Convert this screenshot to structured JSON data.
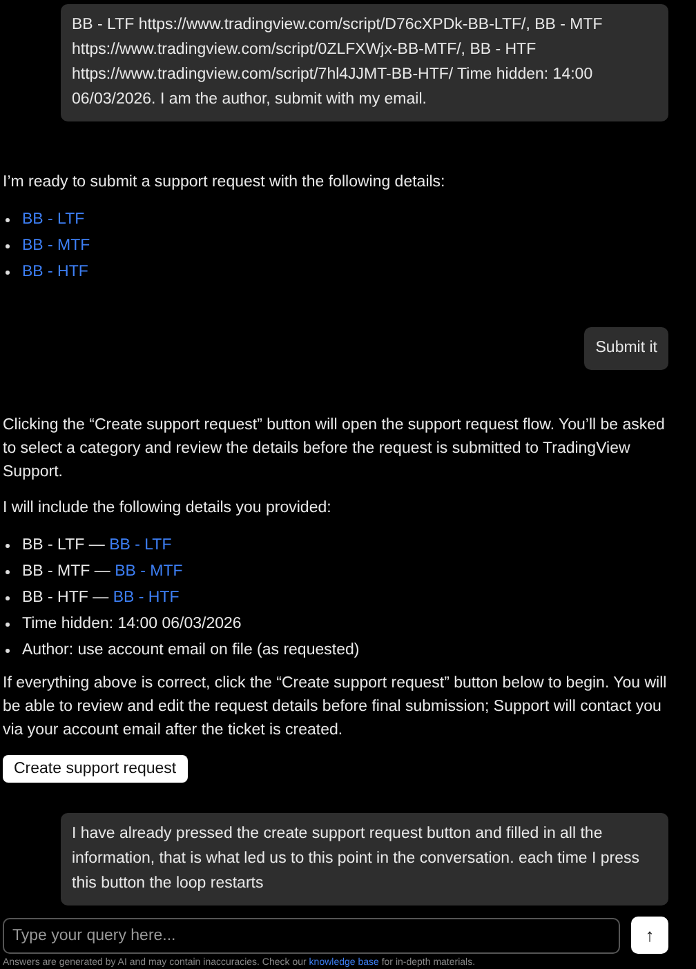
{
  "messages": [
    {
      "kind": "user",
      "text": "BB - LTF https://www.tradingview.com/script/D76cXPDk-BB-LTF/, BB - MTF https://www.tradingview.com/script/0ZLFXWjx-BB-MTF/, BB - HTF https://www.tradingview.com/script/7hl4JJMT-BB-HTF/ Time hidden: 14:00 06/03/2026. I am the author, submit with my email."
    },
    {
      "kind": "bot",
      "blocks": [
        {
          "kind": "para",
          "text": "I’m ready to submit a support request with the following details:"
        },
        {
          "kind": "list",
          "items": [
            {
              "link": "BB - LTF"
            },
            {
              "link": "BB - MTF"
            },
            {
              "link": "BB - HTF"
            }
          ]
        }
      ]
    },
    {
      "kind": "user",
      "text": "Submit it"
    },
    {
      "kind": "bot",
      "blocks": [
        {
          "kind": "para",
          "text": "Clicking the “Create support request” button will open the support request flow. You’ll be asked to select a category and review the details before the request is submitted to TradingView Support."
        },
        {
          "kind": "para",
          "text": "I will include the following details you provided:"
        },
        {
          "kind": "list",
          "items": [
            {
              "text": "BB - LTF —",
              "link": "BB - LTF"
            },
            {
              "text": "BB - MTF —",
              "link": "BB - MTF"
            },
            {
              "text": "BB - HTF —",
              "link": "BB - HTF"
            },
            {
              "text": "Time hidden: 14:00 06/03/2026"
            },
            {
              "text": "Author: use account email on file (as requested)"
            }
          ]
        },
        {
          "kind": "para",
          "text": "If everything above is correct, click the “Create support request” button below to begin. You will be able to review and edit the request details before final submission; Support will contact you via your account email after the ticket is created."
        },
        {
          "kind": "button",
          "label": "Create support request"
        }
      ]
    },
    {
      "kind": "user",
      "text": "I have already pressed the create support request button and filled in all the information, that is what led us to this point in the conversation. each time I press this button the loop restarts"
    }
  ],
  "composer": {
    "placeholder": "Type your query here...",
    "send_label": "↑"
  },
  "disclaimer": {
    "before": "Answers are generated by AI and may contain inaccuracies. Check our",
    "link": "knowledge base",
    "after": "for in-depth materials."
  }
}
